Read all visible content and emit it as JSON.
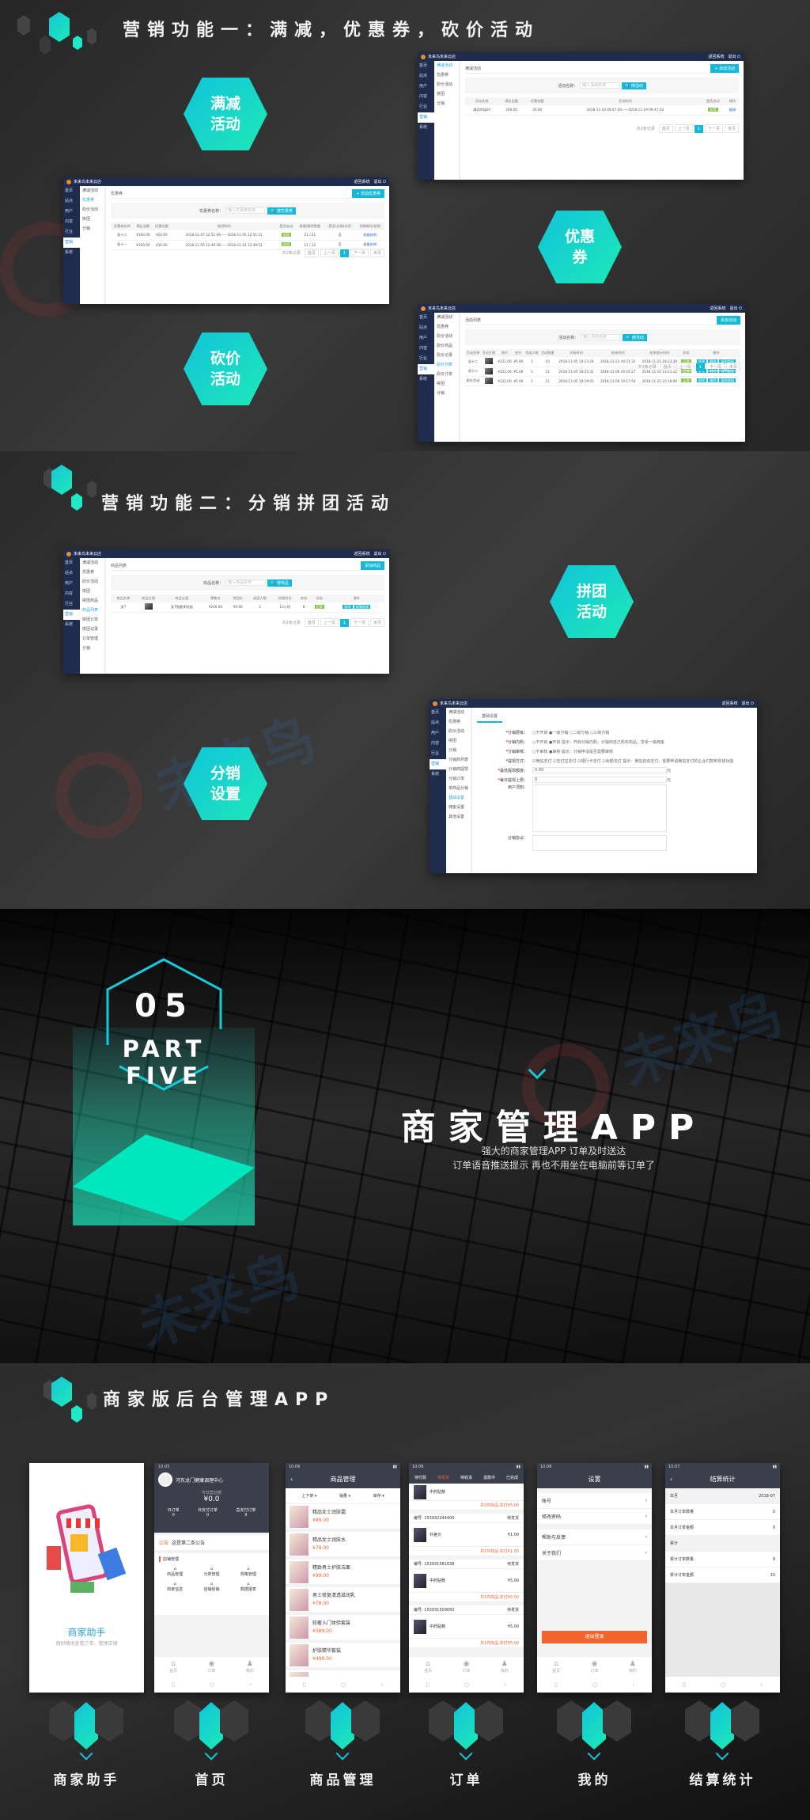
{
  "colors": {
    "accent_start": "#12c3dc",
    "accent_end": "#1de9b6",
    "admin_nav": "#1f2c4d",
    "app_orange": "#f0652d"
  },
  "section1": {
    "title": "营销功能一：满减，优惠券，砍价活动",
    "hex_full_reduce": [
      "满减",
      "活动"
    ],
    "hex_coupon": [
      "优惠",
      "券"
    ],
    "hex_bargain": [
      "砍价",
      "活动"
    ]
  },
  "section2": {
    "title": "营销功能二：分销拼团活动",
    "hex_group": [
      "拼团",
      "活动"
    ],
    "hex_distribution": [
      "分销",
      "设置"
    ]
  },
  "admin_common": {
    "brand": "未来鸟未来云店",
    "back": "返回系统",
    "logout": "退出",
    "nav": [
      "首页",
      "站点",
      "用户",
      "内容",
      "行业",
      "营销",
      "系统"
    ],
    "pager": [
      "共1条记录",
      "首页",
      "上一页",
      "1",
      "下一页",
      "末页"
    ]
  },
  "shot_full_reduce": {
    "sub": [
      "满减活动",
      "优惠券",
      "砍价活动",
      "拼团",
      "分销"
    ],
    "page_title": "满减活动",
    "add": "+ 添加活动",
    "search_label": "活动名称：",
    "search_placeholder": "输入活动名称",
    "search_btn": "搜活动",
    "columns": [
      "活动名称",
      "满足金额",
      "优惠金额",
      "活动时间",
      "是否启动",
      "操作"
    ],
    "rows": [
      [
        "满200减20",
        "200.00",
        "20.00",
        "2018-11-10 09:47:20——2018-11-19 09:47:23",
        "启用",
        "编辑"
      ]
    ]
  },
  "shot_coupon": {
    "sub": [
      "满减活动",
      "优惠券",
      "砍价活动",
      "拼团",
      "分销"
    ],
    "page_title": "优惠券",
    "add": "+ 添加优惠券",
    "search_label": "优惠券名称：",
    "search_placeholder": "输入优惠券名称",
    "search_btn": "搜优惠券",
    "columns": [
      "优惠券名称",
      "满足金额",
      "优惠金额",
      "使用时间",
      "是否启动",
      "数量/剩余数量",
      "是否(店铺)共用",
      "领取情况/核销"
    ],
    "rows": [
      [
        "双十二",
        "¥100.00",
        "¥20.00",
        "2018-11-07 12:51:06——2018-11-05 12:51:11",
        "启用",
        "21 / 21",
        "否",
        "查看核销"
      ],
      [
        "双十一",
        "¥100.00",
        "¥10.00",
        "2018-11-05 12:49:38——2018-11-14 12:49:51",
        "启用",
        "12 / 12",
        "否",
        "查看核销"
      ]
    ],
    "pager_total": "共2条记录"
  },
  "shot_bargain": {
    "sub": [
      "满减活动",
      "优惠券",
      "砍价活动",
      "砍价商品",
      "砍价记录",
      "砍价列表",
      "砍价订单",
      "拼团",
      "分销"
    ],
    "page_title": "活动列表",
    "add": "添加活动",
    "search_label": "活动名称：",
    "search_placeholder": "输入活动名称",
    "search_btn": "搜活动",
    "columns": [
      "活动名称",
      "活动主图",
      "原价",
      "底价",
      "完成人数",
      "活动数量",
      "开始时间",
      "结束时间",
      "结束提示时间",
      "状态",
      "操作"
    ],
    "rows": [
      [
        "双十二",
        "",
        "¥122.00",
        "¥5.00",
        "1",
        "10",
        "2018-11-05 19:23:29",
        "2018-11-23 19:21:31",
        "2018-11-22 19:23:39",
        "正常",
        ""
      ],
      [
        "双十二",
        "",
        "¥122.00",
        "¥5.00",
        "1",
        "11",
        "2018-11-05 19:25:31",
        "2018-11-06 19:25:27",
        "2018-11-10 19:25:42",
        "正常",
        ""
      ],
      [
        "砍价活动",
        "",
        "¥122.00",
        "¥5.00",
        "1",
        "11",
        "2018-11-05 19:19:03",
        "2018-11-06 19:17:54",
        "2018-11-22 19:18:09",
        "正常",
        ""
      ]
    ],
    "ops": [
      "修改",
      "删除",
      "复制链接"
    ],
    "pager_total": "共3条记录"
  },
  "shot_group": {
    "sub": [
      "满减活动",
      "优惠券",
      "砍价活动",
      "拼团",
      "拼团商品",
      "商品列表",
      "拼团订单",
      "拼团记录",
      "订单管理",
      "分销"
    ],
    "page_title": "商品列表",
    "add": "添加商品",
    "search_label": "商品名称：",
    "search_placeholder": "输入商品名称",
    "search_btn": "搜商品",
    "columns": [
      "商品名称",
      "商品主图",
      "商品分类",
      "零售价",
      "拼团价",
      "成团人数",
      "拼团时长",
      "库存",
      "状态",
      "操作"
    ],
    "rows": [
      [
        "女T",
        "",
        "女T恤夏季短袖",
        "¥200.00",
        "¥9.00",
        "2",
        "12小时",
        "8",
        "正常",
        ""
      ]
    ],
    "ops": [
      "修改",
      "复制链接"
    ]
  },
  "shot_distribution": {
    "sub": [
      "满减活动",
      "优惠券",
      "砍价活动",
      "拼团",
      "分销",
      "分销商列表",
      "分销商提现",
      "分销订单",
      "单商品分销",
      "基础设置",
      "佣金设置",
      "其他设置"
    ],
    "tab": "基础设置",
    "fields": [
      {
        "label": "分销层级：",
        "req": true,
        "value": "○不开启  ●一级分销  ○二级分销  ○三级分销"
      },
      {
        "label": "分销内购：",
        "req": true,
        "value": "○不开启  ●开启    提示：开启分销内购，分销商自己购买商品，享受一级佣金"
      },
      {
        "label": "分销审核：",
        "req": true,
        "value": "○不审核  ●审核    提示：分销申请是否需要审核"
      },
      {
        "label": "提现方式：",
        "req": true,
        "value": "☑微信支付 ☑支付宝支付 ☑银行卡支付 ☑余额支付   提示：微信自动支付，需要申请微信支付的企业付款到零钱功能"
      },
      {
        "label": "最低提现额度：",
        "req": true,
        "value": "0.00",
        "unit": "元"
      },
      {
        "label": "每日提现上限：",
        "req": true,
        "value": "0",
        "unit": "元"
      },
      {
        "label": "用户须知：",
        "req": false,
        "value": ""
      },
      {
        "label": "分销协议：",
        "req": false,
        "value": ""
      }
    ]
  },
  "part_five": {
    "number": "05",
    "label": "PART FIVE",
    "title": "商家管理APP",
    "subtitle_1": "强大的商家管理APP 订单及时送达",
    "subtitle_2": "订单语音推送提示 再也不用坐在电脑前等订单了"
  },
  "section4": {
    "title": "商家版后台管理APP",
    "labels": [
      "商家助手",
      "首页",
      "商品管理",
      "订单",
      "我的",
      "结算统计"
    ],
    "splash": {
      "name": "商家助手",
      "tagline": "随时随地查看订单、管理店铺"
    },
    "home": {
      "time": "10:05",
      "store": "河东龙门健康调理中心",
      "today_label": "今日营业额",
      "today_value": "¥0.0",
      "stats": [
        {
          "label": "日订单",
          "value": "0"
        },
        {
          "label": "日支付订单",
          "value": "0"
        },
        {
          "label": "总支付订单",
          "value": "9"
        }
      ],
      "notice_tag": "公告",
      "notice": "这是第二条公告",
      "shop_mgmt": "店铺管理",
      "grid": [
        "商品管理",
        "分类管理",
        "规格管理",
        "商家信息",
        "店铺促销",
        "数据报表"
      ],
      "tabs": [
        "首页",
        "订单",
        "我的"
      ]
    },
    "goods": {
      "time": "10:06",
      "title": "商品管理",
      "filters": [
        "上下架 ▾",
        "销量 ▾",
        "库存 ▾"
      ],
      "items": [
        {
          "name": "精品女士润肤霜",
          "price": "¥89.00"
        },
        {
          "name": "精品女士润肤水",
          "price": "¥78.00"
        },
        {
          "name": "精致男士护肤洁面",
          "price": "¥99.00"
        },
        {
          "name": "男士修复清透滋润乳",
          "price": "¥78.00"
        },
        {
          "name": "轻奢入门体验套装",
          "price": "¥589.00"
        },
        {
          "name": "护肤精华套装",
          "price": "¥499.00"
        },
        {
          "name": "艾灸健康养生疗法",
          "price": ""
        }
      ]
    },
    "orders": {
      "time": "10:06",
      "tabs": [
        "待付款",
        "待发货",
        "待收货",
        "退款中",
        "已完成"
      ],
      "list": [
        {
          "no": "",
          "item": "中药贴敷",
          "price": "",
          "total": "共1件商品 实付¥5.00"
        },
        {
          "no": "编号: 153932244400",
          "item": "补差价",
          "price": "¥1.00",
          "total": "共1件商品 实付¥1.00"
        },
        {
          "no": "编号: 153931581838",
          "item": "中药贴敷",
          "price": "¥5.00",
          "total": "共1件商品 实付¥5.00"
        },
        {
          "no": "编号: 153931509050",
          "item": "中药贴敷",
          "price": "¥5.00",
          "total": "共1件商品 实付¥5.00"
        }
      ],
      "status": "待发货",
      "tabs_bottom": [
        "首页",
        "订单",
        "我的"
      ]
    },
    "mine": {
      "time": "10:06",
      "title": "设置",
      "items": [
        "账号",
        "修改密码",
        "帮助与反馈",
        "关于我们"
      ],
      "logout": "退出登录",
      "tabs": [
        "首页",
        "订单",
        "我的"
      ]
    },
    "stats": {
      "time": "10:07",
      "title": "结算统计",
      "month_label": "本月",
      "month_value": "2018-07",
      "rows": [
        {
          "label": "本月订单数量",
          "value": "0"
        },
        {
          "label": "本月订单金额",
          "value": "0"
        },
        {
          "label": "累计",
          "value": ""
        },
        {
          "label": "累计订单数量",
          "value": "9"
        },
        {
          "label": "累计订单金额",
          "value": "33"
        }
      ]
    }
  }
}
